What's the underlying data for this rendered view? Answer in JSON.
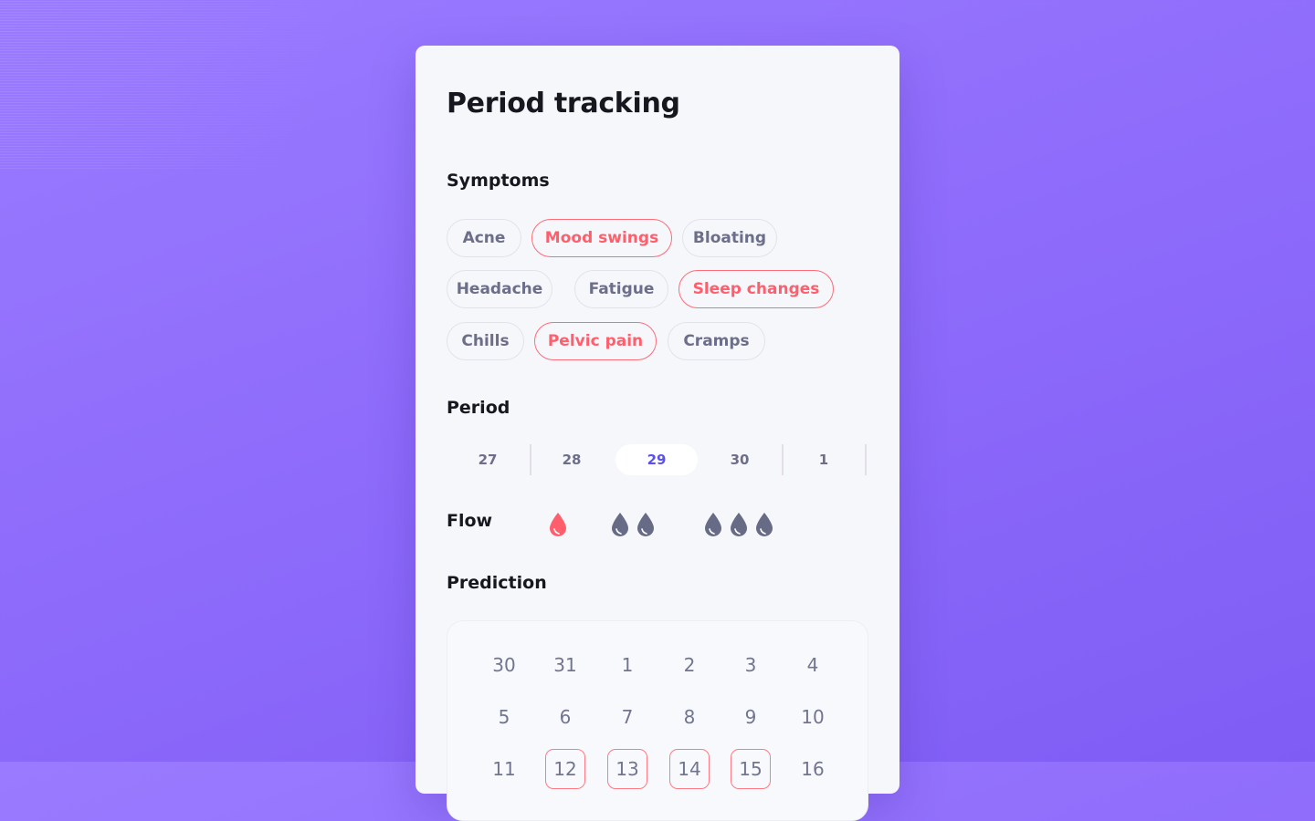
{
  "card": {
    "title": "Period tracking"
  },
  "symptoms": {
    "label": "Symptoms",
    "rows": [
      [
        {
          "label": "Acne",
          "selected": false
        },
        {
          "label": "Mood swings",
          "selected": true
        },
        {
          "label": "Bloating",
          "selected": false
        }
      ],
      [
        {
          "label": "Headache",
          "selected": false
        },
        {
          "label": "Fatigue",
          "selected": false
        },
        {
          "label": "Sleep changes",
          "selected": true
        }
      ],
      [
        {
          "label": "Chills",
          "selected": false
        },
        {
          "label": "Pelvic pain",
          "selected": true
        },
        {
          "label": "Cramps",
          "selected": false
        }
      ]
    ]
  },
  "period": {
    "label": "Period",
    "days": [
      "27",
      "28",
      "29",
      "30",
      "1"
    ],
    "selected_day": "29"
  },
  "flow": {
    "label": "Flow",
    "options": [
      {
        "level": "light",
        "drops": 1,
        "selected": true
      },
      {
        "level": "medium",
        "drops": 2,
        "selected": false
      },
      {
        "level": "heavy",
        "drops": 3,
        "selected": false
      }
    ]
  },
  "prediction": {
    "label": "Prediction",
    "weeks": [
      [
        "30",
        "31",
        "1",
        "2",
        "3",
        "4"
      ],
      [
        "5",
        "6",
        "7",
        "8",
        "9",
        "10"
      ],
      [
        "11",
        "12",
        "13",
        "14",
        "15",
        "16"
      ]
    ],
    "highlighted_days": [
      "12",
      "13",
      "14",
      "15"
    ]
  },
  "colors": {
    "accent_red": "#ff5f6d",
    "accent_blue": "#5a4ff0",
    "muted_text": "#6c6e8a",
    "drop_inactive": "#676b86"
  }
}
